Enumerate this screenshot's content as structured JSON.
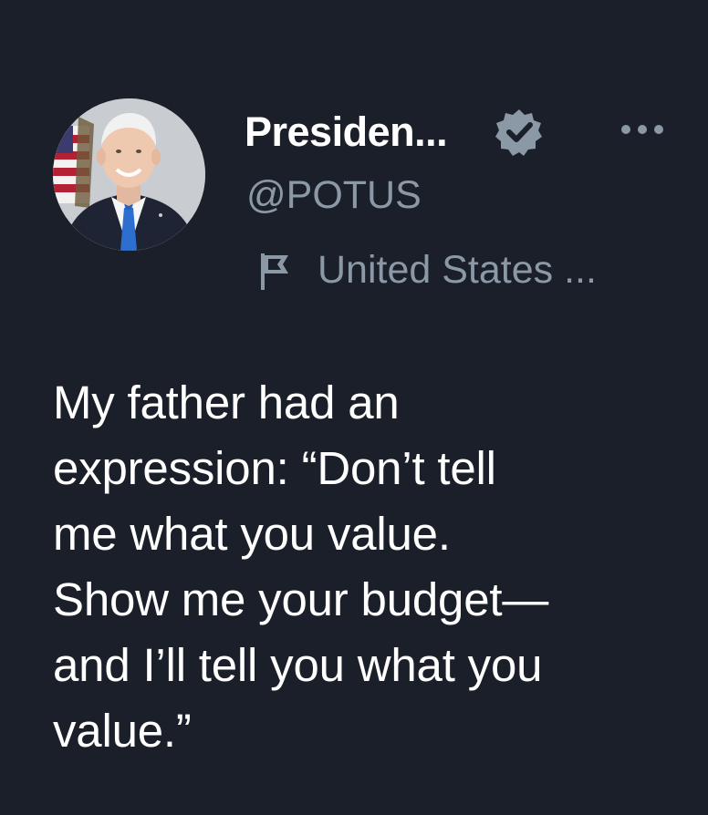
{
  "author": {
    "display_name": "Presiden...",
    "handle": "@POTUS",
    "location": "United States ...",
    "verified_icon": "verified-badge-icon",
    "avatar_icon": "avatar-portrait",
    "more_icon": "more-options-icon"
  },
  "tweet": {
    "text": "My father had an\nexpression: “Don’t tell\nme what you value.\nShow me your budget—\nand I’ll tell you what you\nvalue.”"
  },
  "colors": {
    "background": "#1b1f29",
    "primary_text": "#ffffff",
    "secondary_text": "#8b98a5",
    "badge": "#8b98a5"
  }
}
